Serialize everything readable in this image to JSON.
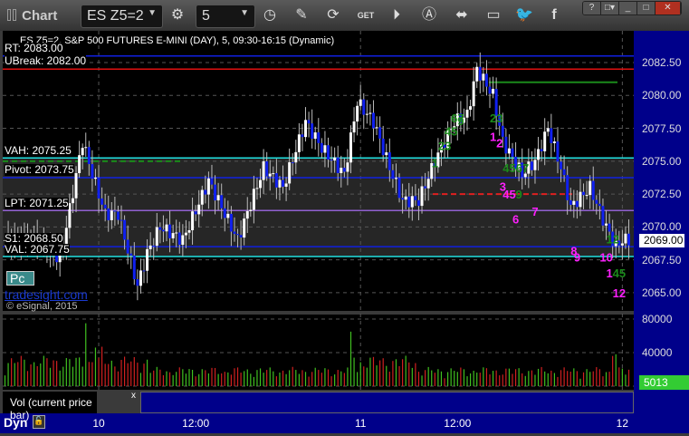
{
  "window": {
    "title": "Chart",
    "symbol": "ES Z5=2",
    "interval": "5",
    "toolbar": [
      "pencil-icon",
      "refresh-icon",
      "get-icon",
      "play-icon",
      "alert-icon",
      "link-icon",
      "comment-icon",
      "twitter-icon",
      "facebook-icon"
    ],
    "win_buttons": [
      "?",
      "□▾",
      "_",
      "□",
      "✕"
    ]
  },
  "chart": {
    "header": "ES Z5=2, S&P 500 FUTURES E-MINI (DAY), 5, 09:30-16:15 (Dynamic)",
    "watermark": "tradesight.com",
    "copyright": "© eSignal, 2015",
    "pc_label": "Pc",
    "current_price": "2069.00",
    "current_volume": "5013",
    "vol_label": "Vol (current price bar)",
    "vol_close": "x",
    "dyn": "Dyn"
  },
  "levels": [
    {
      "label": "RT: 2083.00",
      "price": 2083.0,
      "color": "#1020e0"
    },
    {
      "label": "UBreak: 2082.00",
      "price": 2082.0,
      "color": "#e01010"
    },
    {
      "label": "VAH: 2075.25",
      "price": 2075.25,
      "color": "#20e0e0"
    },
    {
      "label": "Pivot: 2073.75",
      "price": 2073.75,
      "color": "#1020e0"
    },
    {
      "label": "LPT: 2071.25",
      "price": 2071.25,
      "color": "#9060d0"
    },
    {
      "label": "S1: 2068.50",
      "price": 2068.5,
      "color": "#1020e0"
    },
    {
      "label": "VAL: 2067.75",
      "price": 2067.75,
      "color": "#20e0e0"
    }
  ],
  "chart_data": {
    "type": "candlestick",
    "price_ticks": [
      "2082.50",
      "2080.00",
      "2077.50",
      "2075.00",
      "2072.50",
      "2070.00",
      "2067.50",
      "2065.00"
    ],
    "ylim": [
      2063.5,
      2085.5
    ],
    "time_labels": [
      {
        "t": "10",
        "bar": 29
      },
      {
        "t": "12:00",
        "bar": 59
      },
      {
        "t": "11",
        "bar": 110
      },
      {
        "t": "12:00",
        "bar": 140
      },
      {
        "t": "12",
        "bar": 191
      }
    ],
    "bars": 194,
    "path": [
      [
        2,
        2069
      ],
      [
        10,
        2069
      ],
      [
        17,
        2067.5
      ],
      [
        24,
        2076.5
      ],
      [
        27,
        2074
      ],
      [
        31,
        2071
      ],
      [
        35,
        2071
      ],
      [
        41,
        2065.5
      ],
      [
        44,
        2068
      ],
      [
        48,
        2070
      ],
      [
        55,
        2069
      ],
      [
        63,
        2073.5
      ],
      [
        72,
        2069
      ],
      [
        80,
        2074.5
      ],
      [
        86,
        2073
      ],
      [
        93,
        2078
      ],
      [
        98,
        2076
      ],
      [
        105,
        2074
      ],
      [
        109,
        2079.5
      ],
      [
        114,
        2078
      ],
      [
        119,
        2074.5
      ],
      [
        123,
        2072
      ],
      [
        128,
        2072
      ],
      [
        133,
        2075
      ],
      [
        139,
        2078
      ],
      [
        143,
        2078.5
      ],
      [
        146,
        2082
      ],
      [
        151,
        2080
      ],
      [
        154,
        2076.5
      ],
      [
        160,
        2074
      ],
      [
        164,
        2075
      ],
      [
        168,
        2077.5
      ],
      [
        172,
        2074.5
      ],
      [
        175,
        2071.5
      ],
      [
        181,
        2073
      ],
      [
        186,
        2070
      ],
      [
        189,
        2068.5
      ],
      [
        191,
        2069
      ]
    ],
    "vol_ticks": [
      "80000",
      "40000",
      "0"
    ],
    "vol_max": 80000,
    "vol_spikes": [
      [
        25,
        75000
      ],
      [
        28,
        46000
      ],
      [
        30,
        47000
      ],
      [
        107,
        65000
      ],
      [
        108,
        34000
      ],
      [
        188,
        36000
      ],
      [
        189,
        38000
      ]
    ],
    "annotations": [
      {
        "t": "1",
        "bar": 132,
        "p": 2074.9,
        "c": "#1a8a1a"
      },
      {
        "t": "23",
        "bar": 134,
        "p": 2076.2,
        "c": "#1a8a1a"
      },
      {
        "t": "45",
        "bar": 136,
        "p": 2077.3,
        "c": "#1a8a1a"
      },
      {
        "t": "67",
        "bar": 138,
        "p": 2078.3,
        "c": "#1a8a1a"
      },
      {
        "t": "9",
        "bar": 140,
        "p": 2078.1,
        "c": "#1a8a1a"
      },
      {
        "t": "23",
        "bar": 150,
        "p": 2078.3,
        "c": "#1a8a1a"
      },
      {
        "t": "1",
        "bar": 150,
        "p": 2076.9,
        "c": "#ff20ff"
      },
      {
        "t": "2",
        "bar": 152,
        "p": 2076.4,
        "c": "#ff20ff"
      },
      {
        "t": "4567",
        "bar": 154,
        "p": 2074.5,
        "c": "#1a8a1a"
      },
      {
        "t": "3",
        "bar": 153,
        "p": 2073.1,
        "c": "#ff20ff"
      },
      {
        "t": "45",
        "bar": 154,
        "p": 2072.5,
        "c": "#ff20ff"
      },
      {
        "t": "9",
        "bar": 158,
        "p": 2072.5,
        "c": "#1a8a1a"
      },
      {
        "t": "6",
        "bar": 157,
        "p": 2070.6,
        "c": "#ff20ff"
      },
      {
        "t": "7",
        "bar": 163,
        "p": 2071.2,
        "c": "#ff20ff"
      },
      {
        "t": "8",
        "bar": 175,
        "p": 2068.2,
        "c": "#ff20ff"
      },
      {
        "t": "9",
        "bar": 176,
        "p": 2067.7,
        "c": "#ff20ff"
      },
      {
        "t": "12",
        "bar": 186,
        "p": 2069.1,
        "c": "#1a8a1a"
      },
      {
        "t": "10",
        "bar": 184,
        "p": 2067.7,
        "c": "#ff20ff"
      },
      {
        "t": "1",
        "bar": 186,
        "p": 2066.5,
        "c": "#ff20ff"
      },
      {
        "t": "45",
        "bar": 188,
        "p": 2066.5,
        "c": "#1a8a1a"
      },
      {
        "t": "12",
        "bar": 188,
        "p": 2065.0,
        "c": "#ff20ff"
      }
    ]
  }
}
